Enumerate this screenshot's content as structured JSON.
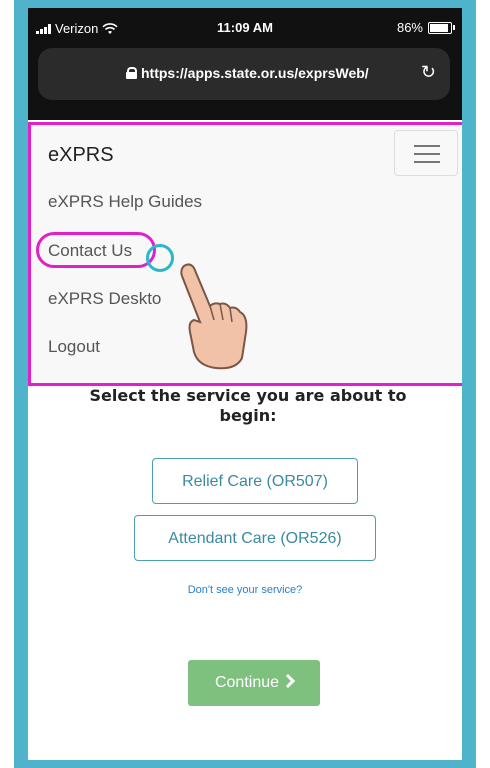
{
  "status_bar": {
    "carrier": "Verizon",
    "time": "11:09 AM",
    "battery": "86%"
  },
  "browser": {
    "url": "https://apps.state.or.us/exprsWeb/"
  },
  "navbar": {
    "brand": "eXPRS",
    "items": [
      {
        "label": "eXPRS Help Guides"
      },
      {
        "label": "Contact Us"
      },
      {
        "label": "eXPRS Deskto"
      },
      {
        "label": "Logout"
      }
    ]
  },
  "main": {
    "title": "Select the service you are about to begin:",
    "services": [
      {
        "label": "Relief Care (OR507)"
      },
      {
        "label": "Attendant Care (OR526)"
      }
    ],
    "help_link": "Don't see your service?",
    "continue_label": "Continue"
  },
  "colors": {
    "highlight": "#e020c8",
    "tap_indicator": "#27b8c9",
    "frame": "#4fb3cc",
    "continue_button": "#7ec17e",
    "service_button_border": "#4b9fb0"
  },
  "icons": [
    "signal-icon",
    "wifi-icon",
    "battery-icon",
    "lock-icon",
    "reload-icon",
    "hamburger-icon",
    "pointing-hand-icon",
    "chevron-right-icon"
  ]
}
